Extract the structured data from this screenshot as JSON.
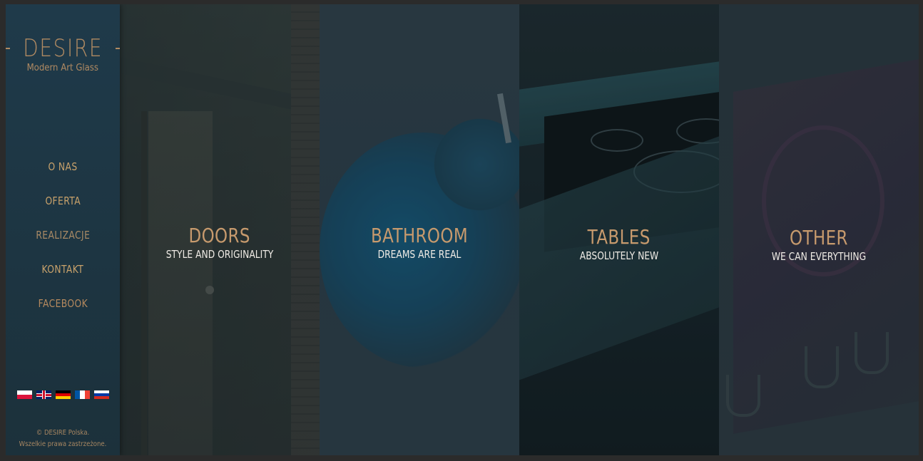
{
  "brand": {
    "title": "DESIRE",
    "subtitle": "Modern Art Glass"
  },
  "nav": {
    "items": [
      {
        "label": "O NAS"
      },
      {
        "label": "OFERTA"
      },
      {
        "label": "REALIZACJE"
      },
      {
        "label": "KONTAKT"
      },
      {
        "label": "FACEBOOK"
      }
    ]
  },
  "languages": [
    {
      "code": "pl",
      "icon": "flag-poland-icon"
    },
    {
      "code": "en",
      "icon": "flag-uk-icon"
    },
    {
      "code": "de",
      "icon": "flag-germany-icon"
    },
    {
      "code": "fr",
      "icon": "flag-france-icon"
    },
    {
      "code": "ru",
      "icon": "flag-russia-icon"
    }
  ],
  "footer": {
    "line1": "© DESIRE Polska.",
    "line2": "Wszelkie prawa zastrzeżone."
  },
  "panels": [
    {
      "title": "DOORS",
      "subtitle": "STYLE AND ORIGINALITY"
    },
    {
      "title": "BATHROOM",
      "subtitle": "DREAMS ARE REAL"
    },
    {
      "title": "TABLES",
      "subtitle": "ABSOLUTELY NEW"
    },
    {
      "title": "OTHER",
      "subtitle": "WE CAN EVERYTHING"
    }
  ],
  "colors": {
    "accent": "#c79a6d",
    "sidebar": "#1f3a4a",
    "background": "#2b2b2b"
  }
}
